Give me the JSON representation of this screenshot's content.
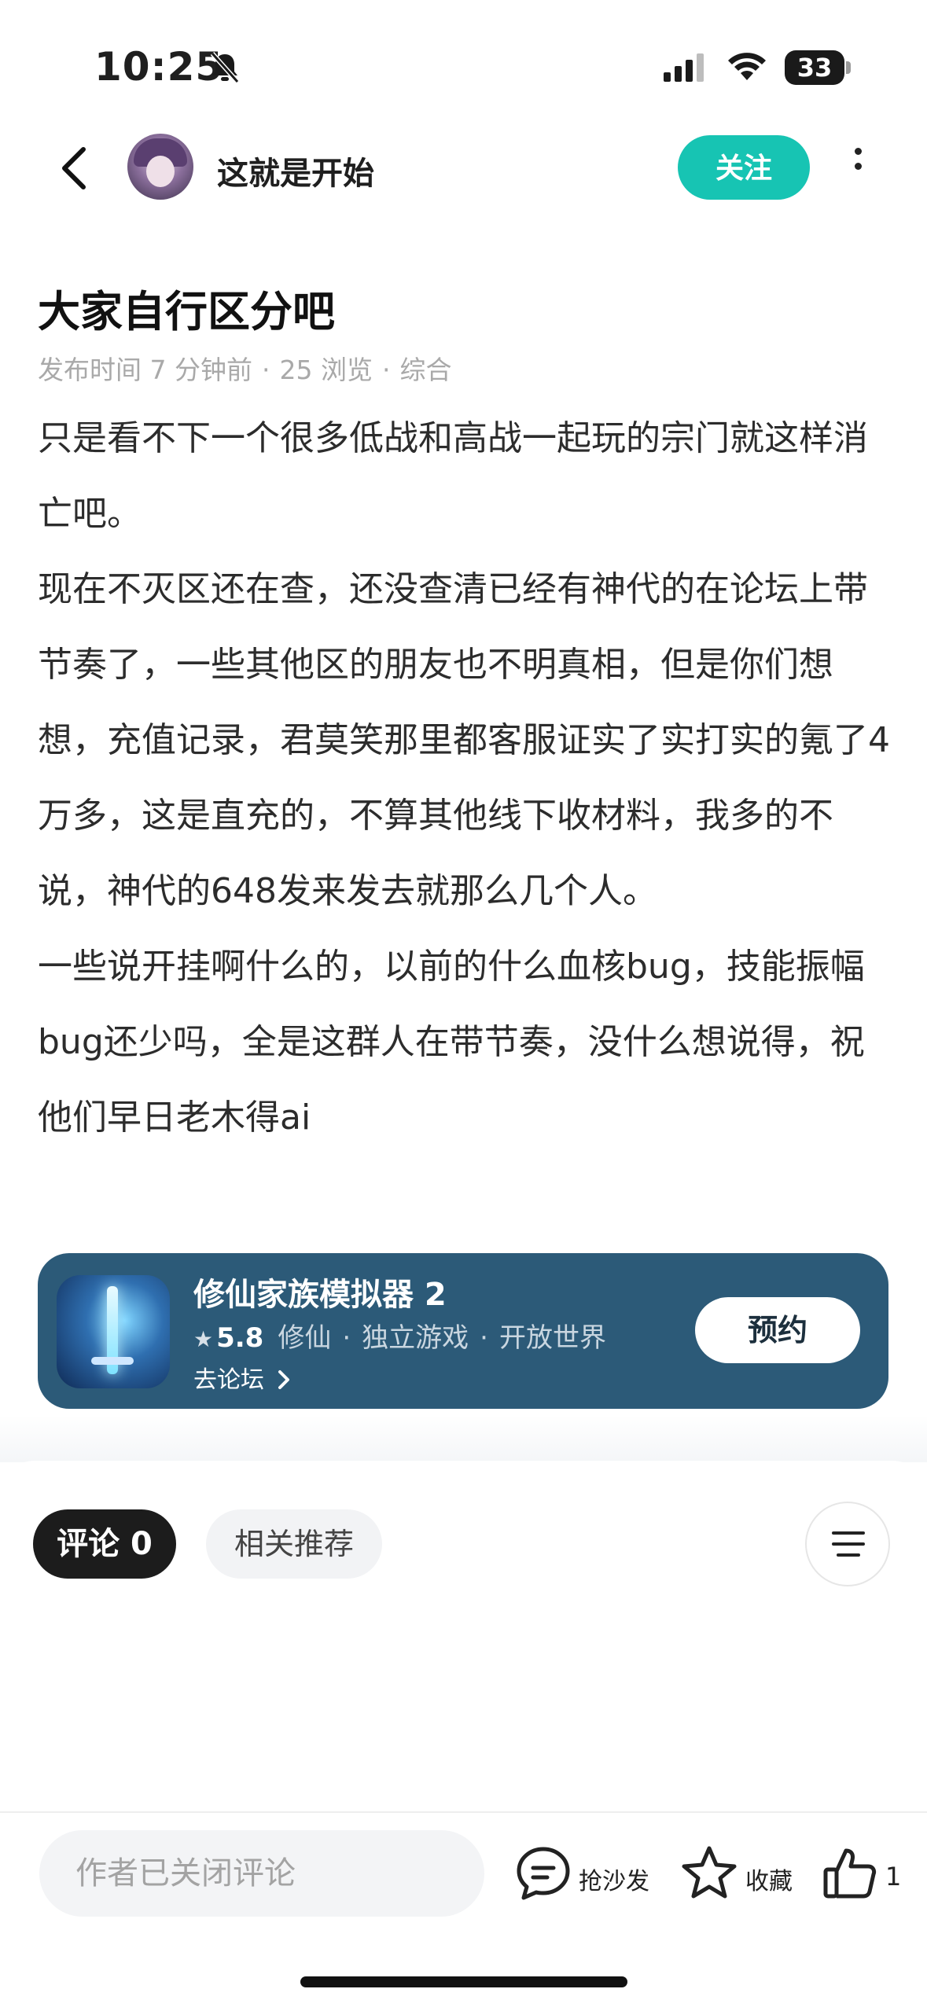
{
  "status_bar": {
    "time": "10:25",
    "battery": "33"
  },
  "header": {
    "author": "这就是开始",
    "follow_label": "关注"
  },
  "post": {
    "title": "大家自行区分吧",
    "meta": {
      "time": "发布时间 7 分钟前",
      "views": "25 浏览",
      "category": "综合"
    },
    "paragraphs": [
      "只是看不下一个很多低战和高战一起玩的宗门就这样消亡吧。",
      "现在不灭区还在查，还没查清已经有神代的在论坛上带节奏了，一些其他区的朋友也不明真相，但是你们想想，充值记录，君莫笑那里都客服证实了实打实的氪了4万多，这是直充的，不算其他线下收材料，我多的不说，神代的648发来发去就那么几个人。",
      "一些说开挂啊什么的，以前的什么血核bug，技能振幅bug还少吗，全是这群人在带节奏，没什么想说得，祝他们早日老木得ai"
    ]
  },
  "game_card": {
    "name": "修仙家族模拟器 2",
    "rating": "5.8",
    "tags": [
      "修仙",
      "独立游戏",
      "开放世界"
    ],
    "forum_link": "去论坛",
    "reserve_label": "预约"
  },
  "comments": {
    "tab_comments": "评论 0",
    "tab_related": "相关推荐"
  },
  "bottom_bar": {
    "input_placeholder": "作者已关闭评论",
    "sofa_label": "抢沙发",
    "fav_label": "收藏",
    "like_count": "1"
  },
  "colors": {
    "accent": "#17c4b3",
    "card_bg": "#2c5a78"
  }
}
